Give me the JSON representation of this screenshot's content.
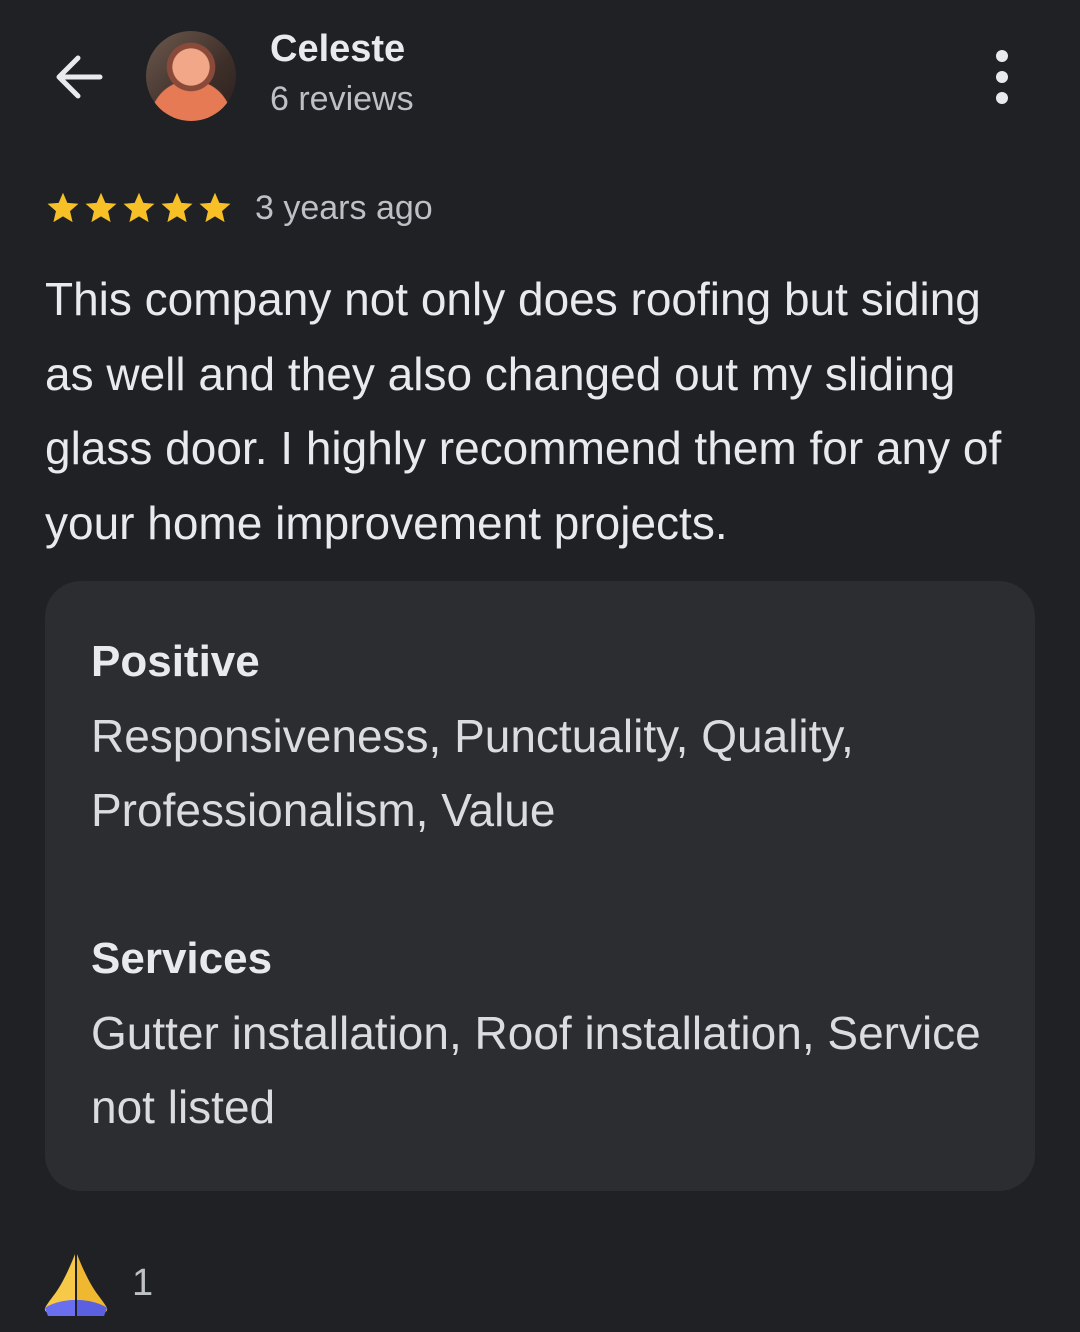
{
  "header": {
    "back_icon": "arrow-back-icon",
    "reviewer_name": "Celeste",
    "reviewer_reviews": "6 reviews",
    "more_icon": "more-vertical-icon"
  },
  "review": {
    "rating": 5,
    "rating_max": 5,
    "star_color": "#f6c026",
    "time": "3 years ago",
    "text": "This company not only does roofing but siding as well and they also changed out my sliding glass door. I highly recommend them for any of your home improvement projects."
  },
  "details": {
    "positive_title": "Positive",
    "positive_body": "Responsiveness, Punctuality, Quality, Professionalism, Value",
    "services_title": "Services",
    "services_body": "Gutter installation, Roof installation, Service not listed"
  },
  "reaction": {
    "icon": "folded-hands-emoji",
    "count": "1"
  },
  "colors": {
    "background": "#202124",
    "card": "#2c2d30",
    "primary_text": "#e8eaed",
    "secondary_text": "#bdc1c6"
  }
}
